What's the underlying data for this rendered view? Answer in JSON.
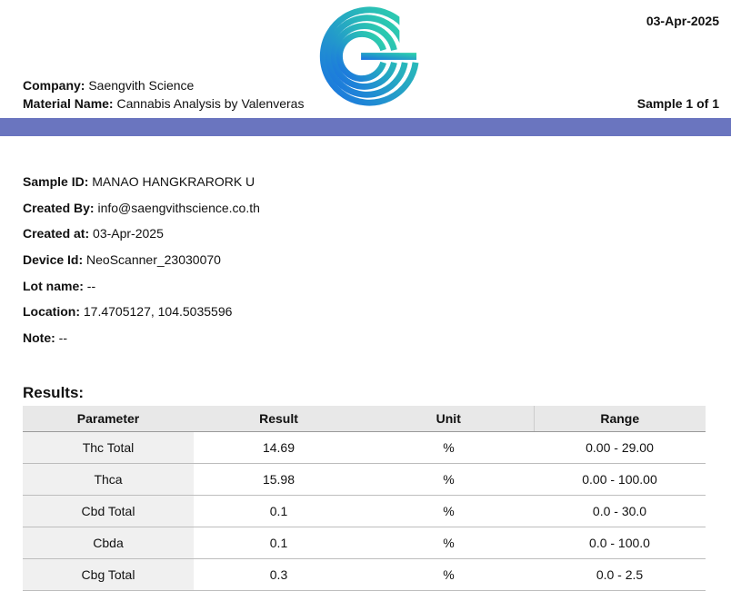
{
  "header": {
    "date": "03-Apr-2025",
    "company_label": "Company:",
    "company_value": "Saengvith Science",
    "material_label": "Material Name:",
    "material_value": "Cannabis Analysis by Valenveras",
    "sample_count": "Sample 1 of 1",
    "logo_icon": "saengvith-logo-icon"
  },
  "colors": {
    "band": "#6a75bf",
    "logo_top": "#2fd7a8",
    "logo_bottom": "#1a6fe3"
  },
  "meta": [
    {
      "label": "Sample ID:",
      "value": "MANAO HANGKRARORK U"
    },
    {
      "label": "Created By:",
      "value": "info@saengvithscience.co.th"
    },
    {
      "label": "Created at:",
      "value": "03-Apr-2025"
    },
    {
      "label": "Device Id:",
      "value": "NeoScanner_23030070"
    },
    {
      "label": "Lot name:",
      "value": "--"
    },
    {
      "label": "Location:",
      "value": "17.4705127, 104.5035596"
    },
    {
      "label": "Note:",
      "value": "--"
    }
  ],
  "results": {
    "title": "Results:",
    "columns": [
      "Parameter",
      "Result",
      "Unit",
      "Range"
    ],
    "rows": [
      [
        "Thc Total",
        "14.69",
        "%",
        "0.00 - 29.00"
      ],
      [
        "Thca",
        "15.98",
        "%",
        "0.00 - 100.00"
      ],
      [
        "Cbd Total",
        "0.1",
        "%",
        "0.0 - 30.0"
      ],
      [
        "Cbda",
        "0.1",
        "%",
        "0.0 - 100.0"
      ],
      [
        "Cbg Total",
        "0.3",
        "%",
        "0.0 - 2.5"
      ]
    ]
  }
}
